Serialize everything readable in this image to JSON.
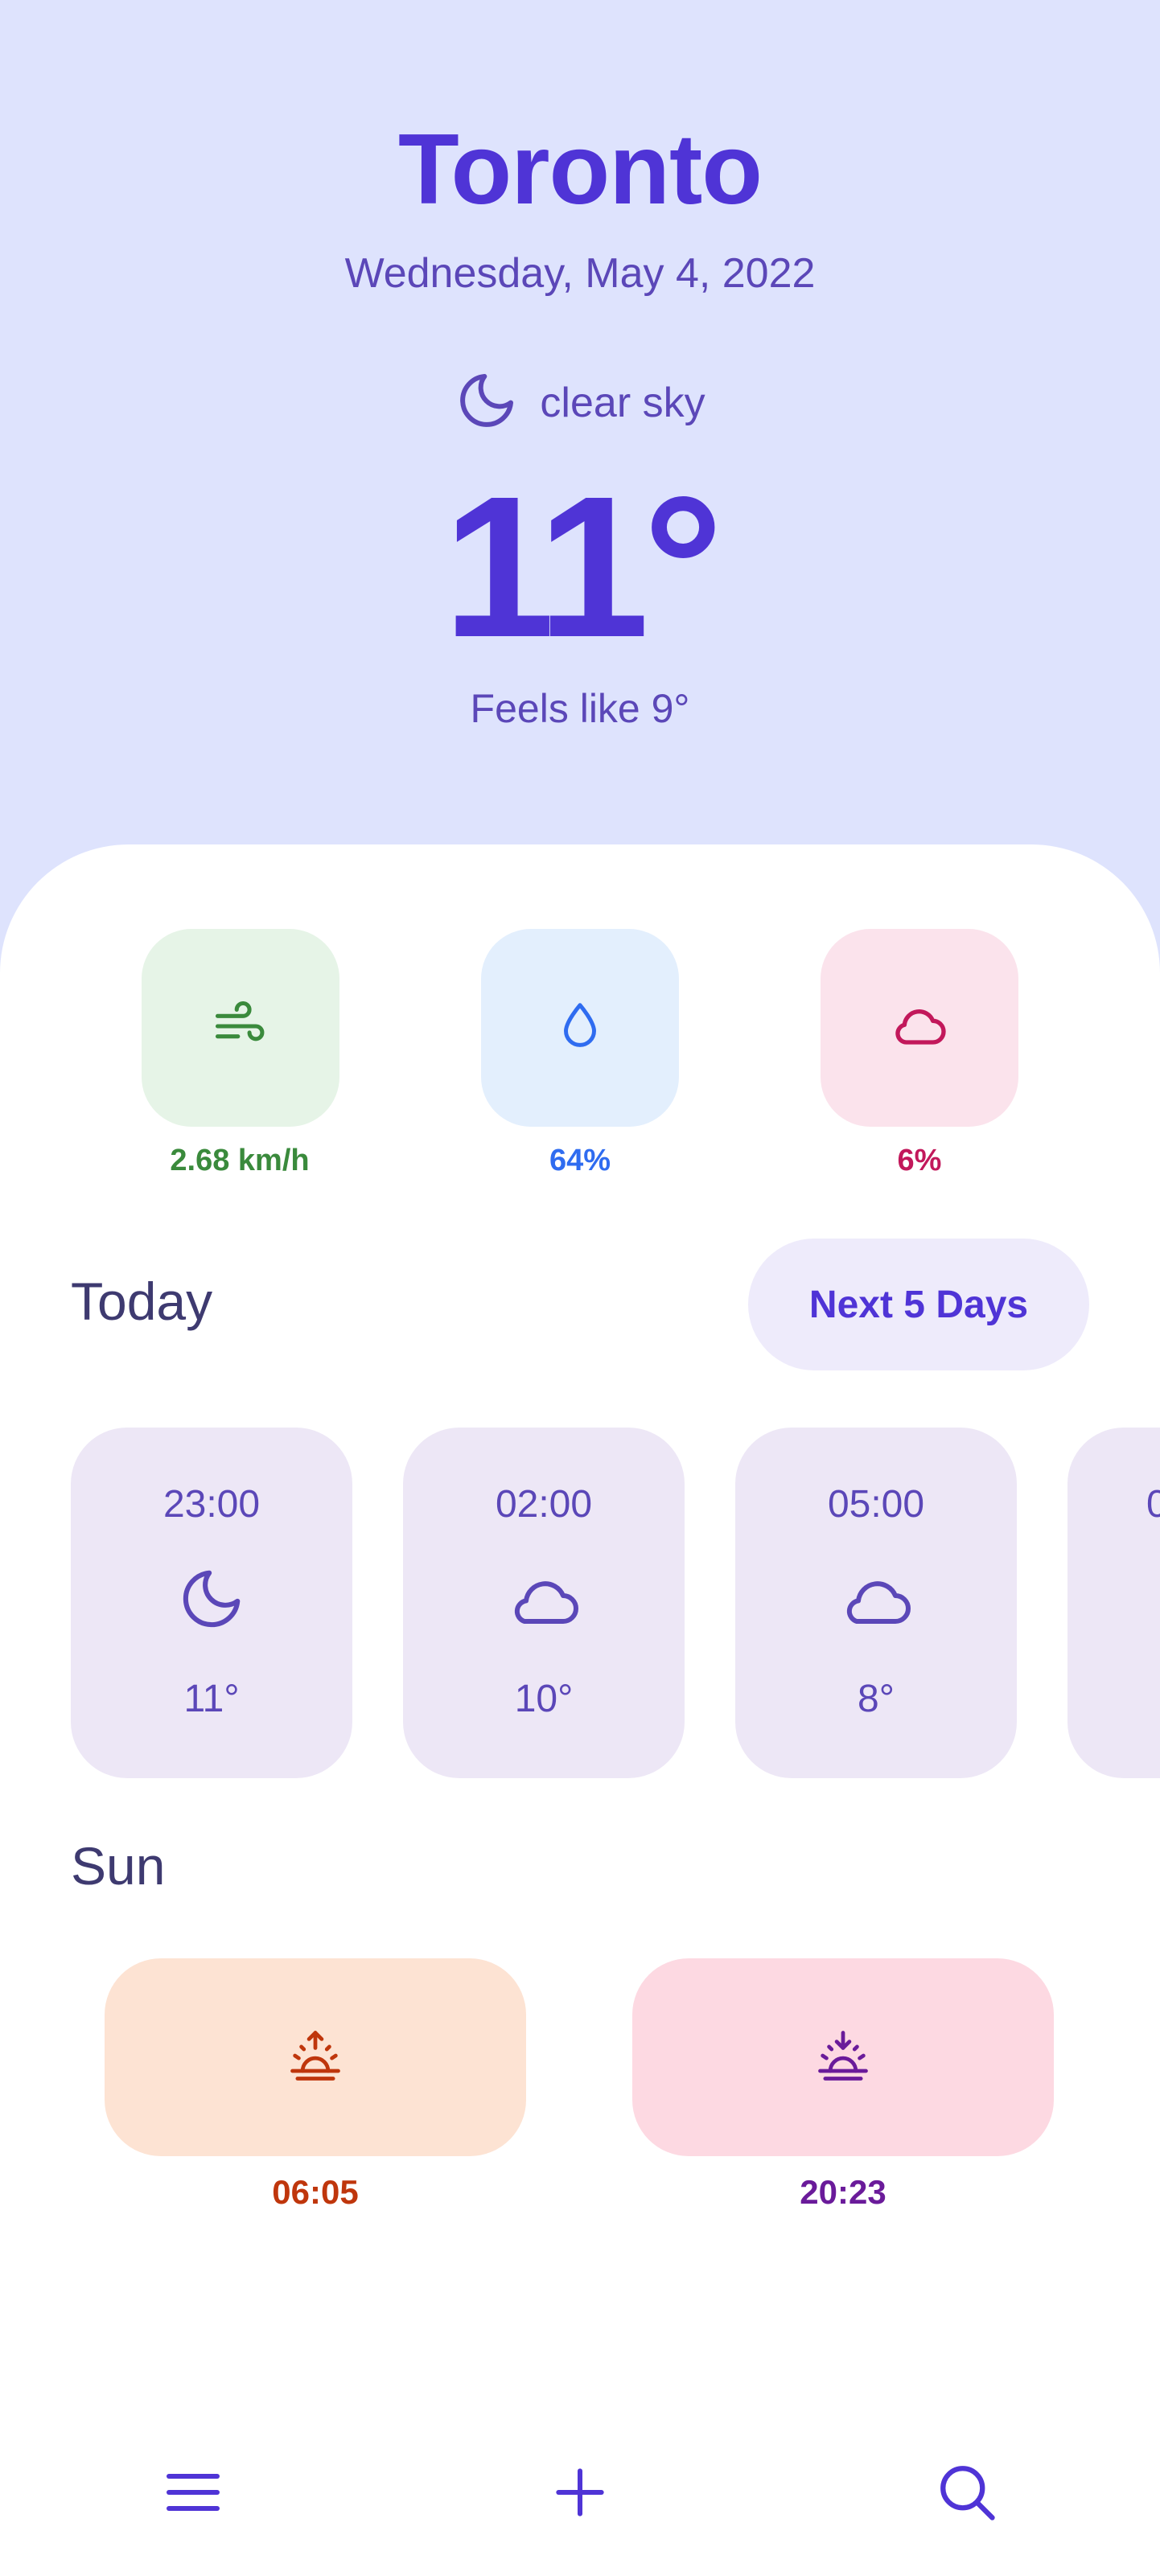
{
  "header": {
    "city": "Toronto",
    "date": "Wednesday, May 4, 2022",
    "condition": "clear sky",
    "condition_icon": "moon-icon",
    "temperature": "11°",
    "feels_like": "Feels like 9°"
  },
  "metrics": {
    "wind": {
      "value": "2.68 km/h",
      "icon": "wind-icon",
      "color": "#3a8a3c",
      "bg": "#e6f4e7"
    },
    "humidity": {
      "value": "64%",
      "icon": "droplet-icon",
      "color": "#2f6cf0",
      "bg": "#e3effd"
    },
    "clouds": {
      "value": "6%",
      "icon": "cloud-icon",
      "color": "#c2185b",
      "bg": "#fbe3ec"
    }
  },
  "today": {
    "title": "Today",
    "next_button": "Next 5 Days",
    "hours": [
      {
        "time": "23:00",
        "icon": "moon-icon",
        "temp": "11°"
      },
      {
        "time": "02:00",
        "icon": "cloud-icon",
        "temp": "10°"
      },
      {
        "time": "05:00",
        "icon": "cloud-icon",
        "temp": "8°"
      },
      {
        "time": "0",
        "icon": "",
        "temp": ""
      }
    ]
  },
  "sun": {
    "title": "Sun",
    "sunrise": {
      "time": "06:05",
      "icon": "sunrise-icon",
      "color": "#bf360c",
      "bg": "#fde3d3"
    },
    "sunset": {
      "time": "20:23",
      "icon": "sunset-icon",
      "color": "#6a1b9a",
      "bg": "#fdd9e2"
    }
  },
  "nav": {
    "items": [
      {
        "icon": "menu-icon"
      },
      {
        "icon": "plus-icon"
      },
      {
        "icon": "search-icon"
      }
    ]
  },
  "colors": {
    "accent": "#4f34d6",
    "header_bg": "#dee3fd",
    "card_bg": "#ede7f6"
  }
}
